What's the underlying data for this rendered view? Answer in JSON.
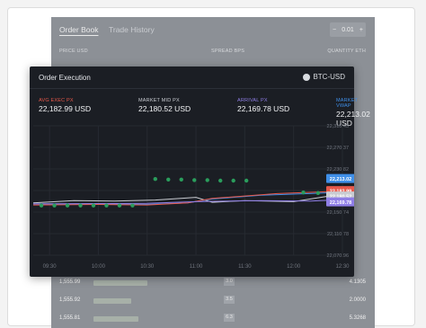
{
  "order_book": {
    "tabs": [
      "Order Book",
      "Trade History"
    ],
    "step_value": "0.01",
    "step_minus": "−",
    "step_plus": "+",
    "columns": [
      "PRICE USD",
      "SPREAD BPS",
      "QUANTITY ETH"
    ],
    "rows": [
      {
        "price": "1,555.99",
        "spread": "3.0",
        "qty": "4.1305",
        "bar": 0.55
      },
      {
        "price": "1,555.92",
        "spread": "3.5",
        "qty": "2.0000",
        "bar": 0.38
      },
      {
        "price": "1,555.81",
        "spread": "6.3",
        "qty": "5.3268",
        "bar": 0.45
      }
    ]
  },
  "execution": {
    "title": "Order Execution",
    "pair": "BTC-USD",
    "stats": [
      {
        "label": "AVG EXEC PX",
        "value": "22,182.99 USD",
        "color": "#e8584a"
      },
      {
        "label": "MARKET MID PX",
        "value": "22,180.52 USD",
        "color": "#c9ccd2"
      },
      {
        "label": "ARRIVAL PX",
        "value": "22,169.78 USD",
        "color": "#8f7ee6"
      },
      {
        "label": "MARKET VWAP",
        "value": "22,213.02 USD",
        "color": "#3f8fe8"
      }
    ]
  },
  "chart_data": {
    "type": "line",
    "x": [
      "09:30",
      "10:00",
      "10:30",
      "11:00",
      "11:30",
      "12:00",
      "12:30"
    ],
    "y_ticks": [
      "22,310.45",
      "22,270.37",
      "22,230.82",
      "22,190.79",
      "22,150.74",
      "22,110.78",
      "22,070.96"
    ],
    "ylim": [
      22070.96,
      22310.45
    ],
    "xlim_minutes_after_0930": [
      -10,
      180
    ],
    "series": [
      {
        "name": "MARKET MID PX",
        "color": "#c9ccd2",
        "points": [
          [
            -10,
            22168
          ],
          [
            15,
            22172
          ],
          [
            40,
            22171
          ],
          [
            65,
            22173
          ],
          [
            90,
            22178
          ],
          [
            100,
            22169
          ],
          [
            120,
            22172
          ],
          [
            150,
            22170
          ],
          [
            175,
            22182
          ]
        ]
      },
      {
        "name": "MARKET VWAP",
        "color": "#3f8fe8",
        "points": [
          [
            -10,
            22166
          ],
          [
            30,
            22166
          ],
          [
            60,
            22165
          ],
          [
            85,
            22168
          ],
          [
            100,
            22175
          ],
          [
            130,
            22182
          ],
          [
            160,
            22185
          ],
          [
            175,
            22187
          ]
        ]
      },
      {
        "name": "AVG EXEC PX",
        "color": "#e8584a",
        "points": [
          [
            -10,
            22164
          ],
          [
            30,
            22165
          ],
          [
            60,
            22164
          ],
          [
            85,
            22168
          ],
          [
            100,
            22176
          ],
          [
            140,
            22185
          ],
          [
            175,
            22189
          ]
        ]
      },
      {
        "name": "ARRIVAL PX",
        "color": "#8f7ee6",
        "points": [
          [
            -10,
            22166
          ],
          [
            60,
            22167
          ],
          [
            90,
            22170
          ],
          [
            130,
            22172
          ],
          [
            160,
            22171
          ],
          [
            175,
            22173
          ]
        ]
      }
    ],
    "fills": [
      {
        "color": "#2a9d5c",
        "points": [
          [
            -5,
            22163
          ],
          [
            3,
            22163
          ],
          [
            11,
            22163
          ],
          [
            19,
            22163
          ],
          [
            27,
            22163
          ],
          [
            35,
            22163
          ],
          [
            43,
            22163
          ],
          [
            51,
            22163
          ]
        ]
      },
      {
        "color": "#2a9d5c",
        "points": [
          [
            65,
            22212
          ],
          [
            73,
            22211
          ],
          [
            81,
            22211
          ],
          [
            89,
            22210
          ],
          [
            97,
            22210
          ],
          [
            105,
            22209
          ],
          [
            113,
            22209
          ],
          [
            121,
            22209
          ]
        ]
      },
      {
        "color": "#2a9d5c",
        "points": [
          [
            156,
            22187
          ],
          [
            165,
            22186
          ]
        ]
      }
    ],
    "badges": [
      {
        "text": "22,213.02",
        "value": 22213.02,
        "color": "#3f8fe8"
      },
      {
        "text": "22,182.99",
        "value": 22190.5,
        "color": "#e8584a"
      },
      {
        "text": "22,180.52",
        "value": 22180.52,
        "color": "#c9ccd2"
      },
      {
        "text": "22,169.78",
        "value": 22169.78,
        "color": "#8f7ee6"
      }
    ]
  }
}
